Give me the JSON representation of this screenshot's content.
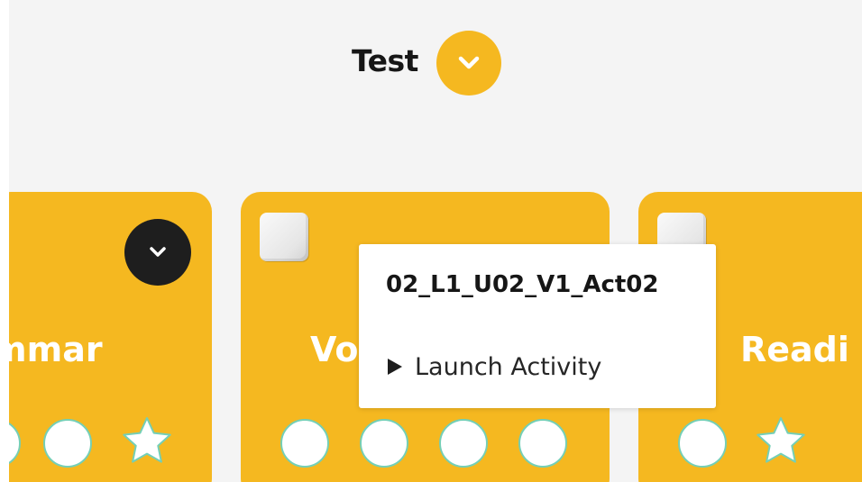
{
  "header": {
    "title": "Test",
    "toggle_icon": "chevron-down-icon",
    "accent_color": "#f5b820"
  },
  "cards": [
    {
      "label": "mmar",
      "expand_icon": "chevron-down-icon",
      "progress_dots": 2,
      "has_star": true
    },
    {
      "label": "Vo",
      "progress_dots": 4,
      "has_star": false,
      "checkbox_checked": false
    },
    {
      "label": "Readi",
      "progress_dots": 1,
      "has_star": true,
      "checkbox_checked": false
    }
  ],
  "popup": {
    "activity_id": "02_L1_U02_V1_Act02",
    "action_label": "Launch Activity",
    "action_icon": "play-icon"
  },
  "colors": {
    "card": "#f5b820",
    "dot_border": "#74cfb6",
    "background": "#f4f4f4"
  }
}
